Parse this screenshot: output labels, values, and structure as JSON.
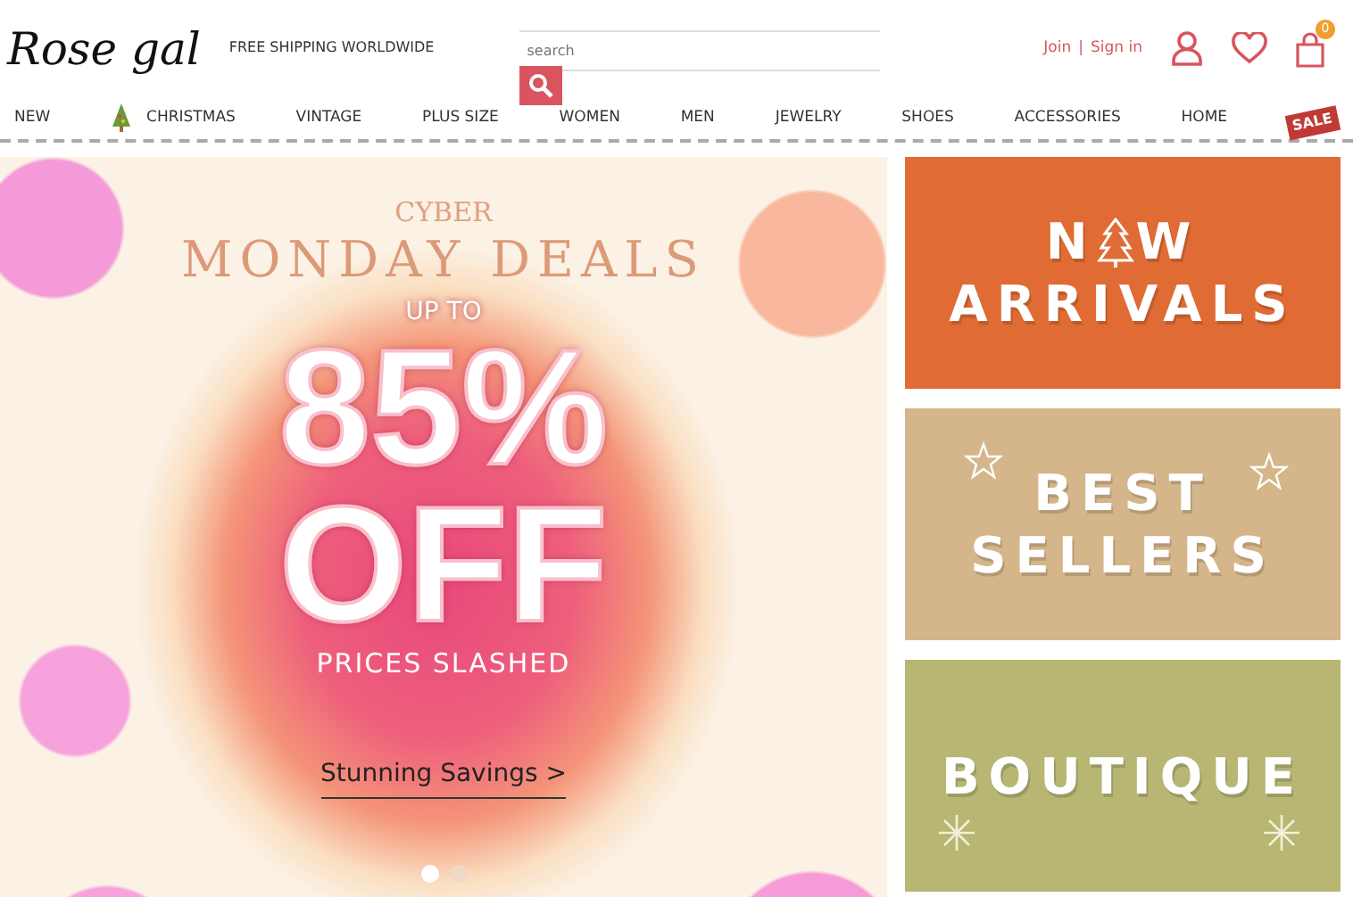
{
  "header": {
    "logo": "Rose gal",
    "shipping_note": "FREE SHIPPING WORLDWIDE",
    "search": {
      "placeholder": "search"
    },
    "join": "Join",
    "separator": "|",
    "sign_in": "Sign in",
    "cart_count": "0"
  },
  "nav": [
    {
      "label": "NEW",
      "kind": "text"
    },
    {
      "label": "CHRISTMAS",
      "kind": "tree"
    },
    {
      "label": "VINTAGE",
      "kind": "text"
    },
    {
      "label": "PLUS SIZE",
      "kind": "text"
    },
    {
      "label": "WOMEN",
      "kind": "text"
    },
    {
      "label": "MEN",
      "kind": "text"
    },
    {
      "label": "JEWELRY",
      "kind": "text"
    },
    {
      "label": "SHOES",
      "kind": "text"
    },
    {
      "label": "ACCESSORIES",
      "kind": "text"
    },
    {
      "label": "HOME",
      "kind": "text"
    },
    {
      "label": "SALE",
      "kind": "sign"
    }
  ],
  "hero": {
    "kicker": "CYBER",
    "title": "MONDAY DEALS",
    "pre": "UP TO",
    "big": "85%",
    "big2": "OFF",
    "sub": "PRICES SLASHED",
    "link": "Stunning Savings >",
    "dots": [
      {
        "selected": true
      },
      {
        "selected": false
      }
    ]
  },
  "banners": [
    {
      "kind": "tree",
      "color": "#e06b34",
      "line1": [
        "N",
        "W"
      ],
      "line2": "ARRIVALS"
    },
    {
      "kind": "stars",
      "color": "#d4b68a",
      "line1": [
        "BEST"
      ],
      "line2": "SELLERS"
    },
    {
      "kind": "snow",
      "color": "#b7b673",
      "line1": [
        "BOUTIQUE"
      ]
    }
  ]
}
